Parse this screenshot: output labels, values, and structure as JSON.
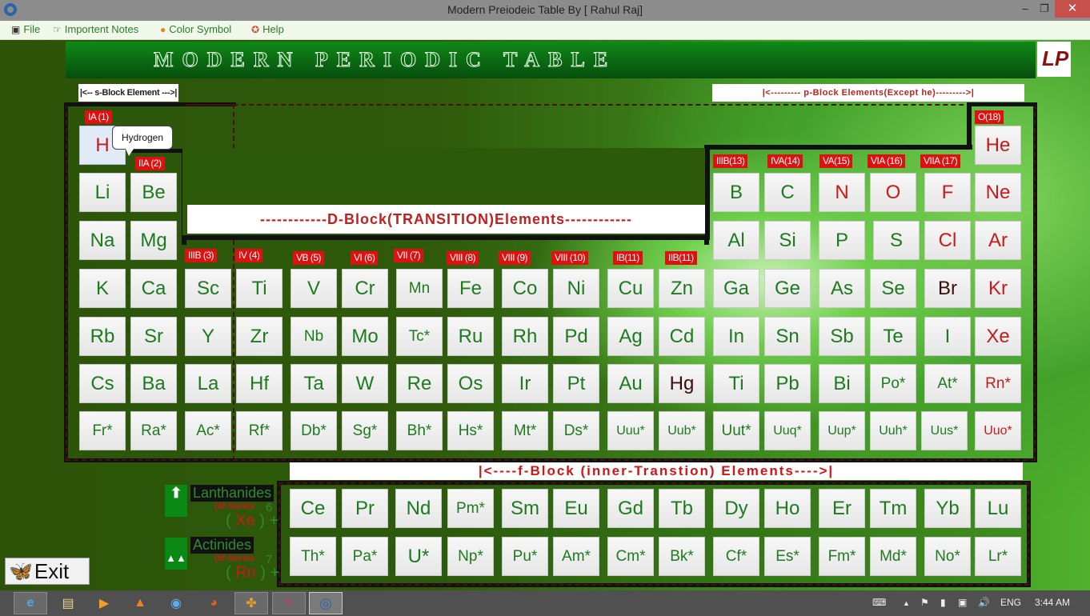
{
  "window": {
    "title": "Modern Preiodeic Table By [ Rahul Raj]",
    "minimize_glyph": "–",
    "maximize_glyph": "❐",
    "close_glyph": "✕"
  },
  "menu": [
    {
      "label": "File",
      "icon": "document-icon",
      "glyph": "▣"
    },
    {
      "label": "Importent Notes",
      "icon": "pointing-hand-icon",
      "glyph": "☞"
    },
    {
      "label": "Color Symbol",
      "icon": "palette-icon",
      "glyph": "●"
    },
    {
      "label": "Help",
      "icon": "lifebuoy-icon",
      "glyph": "✪"
    }
  ],
  "banner": {
    "title": "MODERN PERIODIC TABLE",
    "logo_text": "LP"
  },
  "block_labels": {
    "s": "|<-- s-Block Element --->|",
    "p": "|<--------- p-Block Elements(Except he)--------->|",
    "d": "------------D-Block(TRANSITION)Elements------------",
    "f": "|<----f-Block (inner-Transtion) Elements---->|"
  },
  "groups": {
    "g1": "IA (1)",
    "g2": "IIA (2)",
    "g3": "IIIB (3)",
    "g4": "IV (4)",
    "g5": "VB (5)",
    "g6": "VI (6)",
    "g7": "VII (7)",
    "g8": "VIII (8)",
    "g9": "VIII (9)",
    "g10": "VIII (10)",
    "g11": "IB(11)",
    "g12": "IIB(11)",
    "g13": "IIIB(13)",
    "g14": "IVA(14)",
    "g15": "VA(15)",
    "g16": "VIA (16)",
    "g17": "VIIA (17)",
    "g18": "O(18)"
  },
  "tooltip": "Hydrogen",
  "elements": {
    "H": "H",
    "He": "He",
    "Li": "Li",
    "Be": "Be",
    "B": "B",
    "C": "C",
    "N": "N",
    "O": "O",
    "F": "F",
    "Ne": "Ne",
    "Na": "Na",
    "Mg": "Mg",
    "Al": "Al",
    "Si": "Si",
    "P": "P",
    "S": "S",
    "Cl": "Cl",
    "Ar": "Ar",
    "K": "K",
    "Ca": "Ca",
    "Sc": "Sc",
    "Ti": "Ti",
    "V": "V",
    "Cr": "Cr",
    "Mn": "Mn",
    "Fe": "Fe",
    "Co": "Co",
    "Ni": "Ni",
    "Cu": "Cu",
    "Zn": "Zn",
    "Ga": "Ga",
    "Ge": "Ge",
    "As": "As",
    "Se": "Se",
    "Br": "Br",
    "Kr": "Kr",
    "Rb": "Rb",
    "Sr": "Sr",
    "Y": "Y",
    "Zr": "Zr",
    "Nb": "Nb",
    "Mo": "Mo",
    "Tc": "Tc*",
    "Ru": "Ru",
    "Rh": "Rh",
    "Pd": "Pd",
    "Ag": "Ag",
    "Cd": "Cd",
    "In": "In",
    "Sn": "Sn",
    "Sb": "Sb",
    "Te": "Te",
    "I": "I",
    "Xe": "Xe",
    "Cs": "Cs",
    "Ba": "Ba",
    "La": "La",
    "Hf": "Hf",
    "Ta": "Ta",
    "W": "W",
    "Re": "Re",
    "Os": "Os",
    "Ir": "Ir",
    "Pt": "Pt",
    "Au": "Au",
    "Hg": "Hg",
    "Tl": "Ti",
    "Pb": "Pb",
    "Bi": "Bi",
    "Po": "Po*",
    "At": "At*",
    "Rn": "Rn*",
    "Fr": "Fr*",
    "Ra": "Ra*",
    "Ac": "Ac*",
    "Rf": "Rf*",
    "Db": "Db*",
    "Sg": "Sg*",
    "Bh": "Bh*",
    "Hs": "Hs*",
    "Mt": "Mt*",
    "Ds": "Ds*",
    "Uuu": "Uuu*",
    "Uub": "Uub*",
    "Uut": "Uut*",
    "Uuq": "Uuq*",
    "Uup": "Uup*",
    "Uuh": "Uuh*",
    "Uus": "Uus*",
    "Uuo": "Uuo*"
  },
  "lanthanides": [
    "Ce",
    "Pr",
    "Nd",
    "Pm*",
    "Sm",
    "Eu",
    "Gd",
    "Tb",
    "Dy",
    "Ho",
    "Er",
    "Tm",
    "Yb",
    "Lu"
  ],
  "actinides": [
    "Th*",
    "Pa*",
    "U*",
    "Np*",
    "Pu*",
    "Am*",
    "Cm*",
    "Bk*",
    "Cf*",
    "Es*",
    "Fm*",
    "Md*",
    "No*",
    "Lr*"
  ],
  "series": {
    "lanthanides": {
      "name": "Lanthanides",
      "sub": "(4f-Series",
      "core_open": "(",
      "core": "Xe",
      "core_close": ")",
      "period": "6",
      "plus": "+",
      "arrow": "⬆"
    },
    "actinides": {
      "name": "Actinides",
      "sub": "(5f-Series",
      "core_open": "(",
      "core": "Rn",
      "core_close": ")",
      "period": "7",
      "plus": "+",
      "arrow": "▲▲"
    }
  },
  "exit_label": "Exit",
  "taskbar": {
    "apps": [
      {
        "name": "internet-explorer",
        "glyph": "e"
      },
      {
        "name": "file-explorer",
        "glyph": "▤"
      },
      {
        "name": "media-player",
        "glyph": "▶"
      },
      {
        "name": "vlc",
        "glyph": "▲"
      },
      {
        "name": "app-blue",
        "glyph": "◉"
      },
      {
        "name": "firefox",
        "glyph": "◕"
      },
      {
        "name": "app-puzzle",
        "glyph": "✤"
      },
      {
        "name": "app-pen",
        "glyph": "✎"
      },
      {
        "name": "periodic-table-app",
        "glyph": "◎"
      }
    ],
    "language": "ENG",
    "time": "3:44 AM"
  }
}
